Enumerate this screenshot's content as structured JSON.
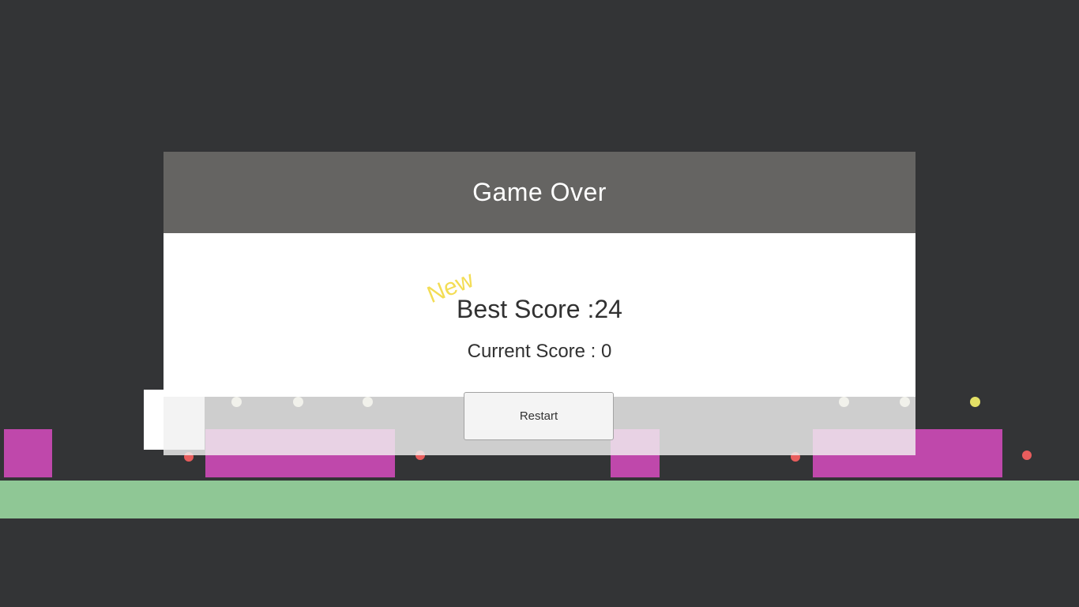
{
  "game_over": {
    "title": "Game Over",
    "new_badge": "New",
    "best_score": "Best Score :24",
    "current_score": "Current Score : 0",
    "restart_label": "Restart"
  },
  "colors": {
    "background": "#333436",
    "panel_header": "#656462",
    "obstacle": "#bf48ab",
    "ground": "#8fc795",
    "player": "#ffffff",
    "coin_pale": "#f3f1cf",
    "coin_yellow": "#e4e066",
    "hazard_red": "#e85d5d",
    "new_badge": "#f3dd55"
  }
}
